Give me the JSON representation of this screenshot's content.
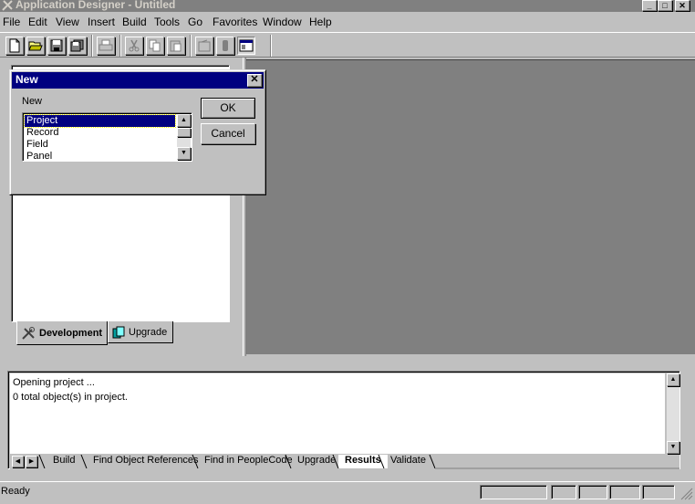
{
  "window": {
    "title": "Application Designer - Untitled",
    "controls": {
      "minimize": "_",
      "maximize": "□",
      "close": "✕"
    }
  },
  "menu": {
    "items": [
      "File",
      "Edit",
      "View",
      "Insert",
      "Build",
      "Tools",
      "Go",
      "Favorites",
      "Window",
      "Help"
    ]
  },
  "toolbar": {
    "buttons": [
      "new-icon",
      "open-icon",
      "save-icon",
      "save-all-icon",
      "print-icon",
      "cut-icon",
      "copy-icon",
      "paste-icon",
      "properties-icon",
      "find-icon",
      "project-workspace-icon"
    ]
  },
  "project_pane": {
    "tabs": [
      {
        "label": "Development",
        "icon": "tools-icon",
        "active": true
      },
      {
        "label": "Upgrade",
        "icon": "upgrade-icon",
        "active": false
      }
    ]
  },
  "dialog": {
    "title": "New",
    "list_label": "New",
    "items": [
      "Project",
      "Record",
      "Field",
      "Panel"
    ],
    "selected_index": 0,
    "ok_label": "OK",
    "cancel_label": "Cancel",
    "close_glyph": "✕"
  },
  "output": {
    "lines": [
      "Opening project ...",
      "0  total object(s) in project."
    ],
    "tabs": [
      "Build",
      "Find Object References",
      "Find in PeopleCode",
      "Upgrade",
      "Results",
      "Validate"
    ],
    "active_tab": "Results"
  },
  "status": {
    "text": "Ready"
  },
  "colors": {
    "face": "#c0c0c0",
    "workspace": "#808080",
    "title_active": "#000080",
    "title_inactive": "#808080"
  }
}
